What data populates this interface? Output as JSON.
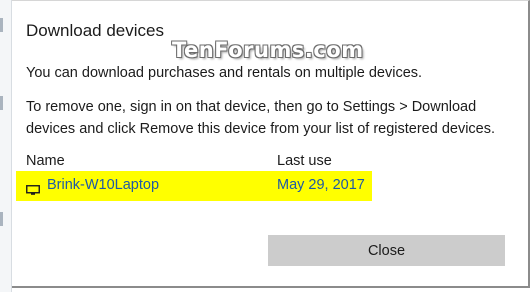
{
  "dialog": {
    "title": "Download devices",
    "description": "You can download purchases and rentals on multiple devices.",
    "instructions": "To remove one, sign in on that device, then go to Settings > Download devices and click Remove this device from your list of registered devices."
  },
  "watermark": {
    "text": "TenForums.com"
  },
  "devices_table": {
    "columns": [
      "Name",
      "Last use"
    ],
    "rows": [
      {
        "icon": "monitor-icon",
        "name": "Brink-W10Laptop",
        "last_use": "May 29, 2017"
      }
    ],
    "highlight_color": "#ffff00"
  },
  "buttons": {
    "close_label": "Close"
  }
}
